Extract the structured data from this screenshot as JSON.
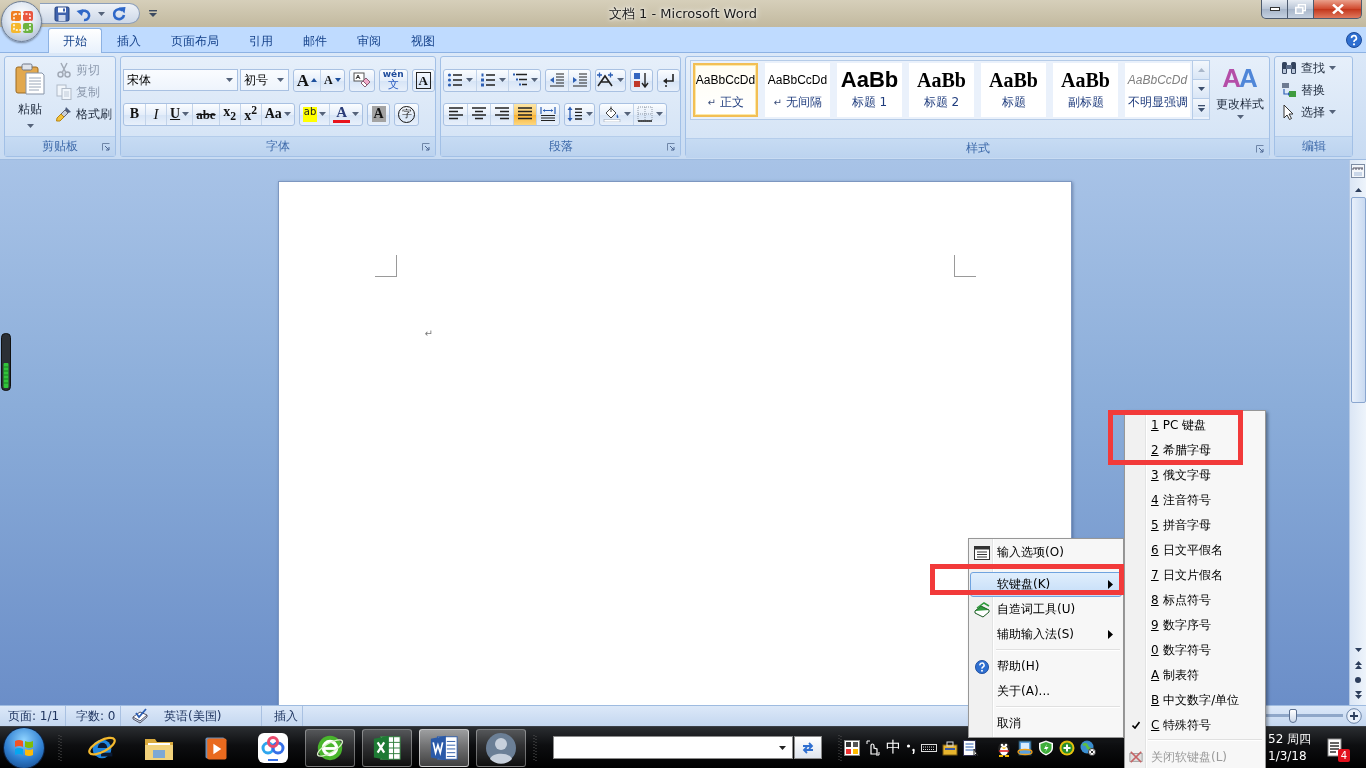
{
  "window": {
    "title": "文档 1 - Microsoft Word"
  },
  "tabs": [
    {
      "label": "开始",
      "selected": true
    },
    {
      "label": "插入",
      "selected": false
    },
    {
      "label": "页面布局",
      "selected": false
    },
    {
      "label": "引用",
      "selected": false
    },
    {
      "label": "邮件",
      "selected": false
    },
    {
      "label": "审阅",
      "selected": false
    },
    {
      "label": "视图",
      "selected": false
    }
  ],
  "clipboard": {
    "title": "剪贴板",
    "paste": "粘贴",
    "items": [
      {
        "kind": "cut",
        "label": "剪切",
        "disabled": true
      },
      {
        "kind": "copy",
        "label": "复制",
        "disabled": true
      },
      {
        "kind": "painter",
        "label": "格式刷",
        "disabled": false
      }
    ]
  },
  "font": {
    "title": "字体",
    "font_name": "宋体",
    "font_size": "初号",
    "row1": [
      [
        {
          "kind": "grow",
          "text": "A",
          "dropdown": false
        },
        {
          "kind": "shrink",
          "text": "A",
          "dropdown": false
        }
      ],
      [
        {
          "kind": "clear",
          "dropdown": false
        }
      ],
      [
        {
          "kind": "phonetic",
          "text": "wén",
          "base": "文",
          "dropdown": false
        }
      ],
      [
        {
          "kind": "border",
          "text": "A",
          "dropdown": false
        }
      ]
    ],
    "row2": [
      [
        {
          "kind": "bold",
          "text": "B",
          "dropdown": false
        },
        {
          "kind": "italic",
          "text": "I",
          "dropdown": false
        },
        {
          "kind": "underline",
          "text": "U",
          "dropdown": true
        },
        {
          "kind": "strike",
          "text": "abe",
          "dropdown": false
        },
        {
          "kind": "sub",
          "text": "x$_{2}$",
          "dropdown": false
        },
        {
          "kind": "sup",
          "text": "x$^{2}$",
          "dropdown": false
        },
        {
          "kind": "case",
          "text": "Aa",
          "dropdown": true
        }
      ],
      [
        {
          "kind": "highlight",
          "text": "ab",
          "dropdown": true
        },
        {
          "kind": "color",
          "text": "A",
          "dropdown": true
        }
      ],
      [
        {
          "kind": "shading",
          "text": "A",
          "dropdown": false
        }
      ],
      [
        {
          "kind": "enclose",
          "text": "字",
          "dropdown": false
        }
      ]
    ]
  },
  "paragraph": {
    "title": "段落",
    "alignment": [
      {
        "kind": "left",
        "selected": false
      },
      {
        "kind": "center",
        "selected": false
      },
      {
        "kind": "right",
        "selected": false
      },
      {
        "kind": "justify",
        "selected": true
      },
      {
        "kind": "distributed",
        "selected": false
      }
    ]
  },
  "styles": {
    "title": "样式",
    "gallery": [
      {
        "kind": "normal",
        "preview": "AaBbCcDd",
        "mark": "↵",
        "name": "正文",
        "selected": true
      },
      {
        "kind": "no-spacing",
        "preview": "AaBbCcDd",
        "mark": "↵",
        "name": "无间隔",
        "selected": false
      },
      {
        "kind": "heading1",
        "preview": "AaBb",
        "name": "标题 1",
        "selected": false
      },
      {
        "kind": "heading2",
        "preview": "AaBb",
        "name": "标题 2",
        "selected": false
      },
      {
        "kind": "title",
        "preview": "AaBb",
        "name": "标题",
        "selected": false
      },
      {
        "kind": "subtitle",
        "preview": "AaBb",
        "name": "副标题",
        "selected": false
      },
      {
        "kind": "emphasis",
        "preview": "AaBbCcDd",
        "name": "不明显强调",
        "selected": false
      }
    ],
    "change": {
      "glyph": "AA",
      "label": "更改样式"
    }
  },
  "editing": {
    "title": "编辑",
    "items": [
      {
        "kind": "find",
        "label": "查找",
        "dropdown": true
      },
      {
        "kind": "replace",
        "label": "替换",
        "dropdown": false
      },
      {
        "kind": "select",
        "label": "选择",
        "dropdown": true
      }
    ]
  },
  "document": {
    "paragraph_mark": "↵"
  },
  "status_bar": {
    "page": "页面: 1/1",
    "words": "字数: 0",
    "language": "英语(美国)",
    "mode": "插入",
    "zoom": {
      "level": 0.5
    }
  },
  "taskbar": {
    "apps": [
      {
        "kind": "ie",
        "running": false,
        "selected": false
      },
      {
        "kind": "folder",
        "running": false,
        "selected": false
      },
      {
        "kind": "media",
        "running": false,
        "selected": false
      },
      {
        "kind": "cloud",
        "running": false,
        "selected": false
      },
      {
        "kind": "browser360",
        "running": true,
        "selected": false
      },
      {
        "kind": "excel",
        "running": true,
        "selected": false
      },
      {
        "kind": "word",
        "running": true,
        "selected": true
      },
      {
        "kind": "avatar",
        "running": true,
        "selected": false
      }
    ],
    "ime": "中",
    "clock": {
      "time": "52 周四",
      "date": "1/3/18"
    },
    "notifications": "4"
  },
  "context_menu": {
    "items": [
      {
        "kind": "options",
        "label": "输入选项(O)",
        "selected": false,
        "submenu": false
      },
      {
        "kind": "separator"
      },
      {
        "kind": "command",
        "label": "软键盘(K)",
        "selected": true,
        "submenu": true
      },
      {
        "kind": "wordtool",
        "label": "自造词工具(U)",
        "selected": false,
        "submenu": false
      },
      {
        "kind": "command",
        "label": "辅助输入法(S)",
        "selected": false,
        "submenu": true
      },
      {
        "kind": "separator"
      },
      {
        "kind": "help",
        "label": "帮助(H)",
        "selected": false,
        "submenu": false
      },
      {
        "kind": "command",
        "label": "关于(A)...",
        "selected": false,
        "submenu": false
      },
      {
        "kind": "separator"
      },
      {
        "kind": "command",
        "label": "取消",
        "selected": false,
        "submenu": false
      }
    ]
  },
  "soft_keyboard_menu": {
    "items": [
      {
        "key": "1",
        "label": "PC 键盘",
        "checked": false
      },
      {
        "key": "2",
        "label": "希腊字母",
        "checked": false
      },
      {
        "key": "3",
        "label": "俄文字母",
        "checked": false
      },
      {
        "key": "4",
        "label": "注音符号",
        "checked": false
      },
      {
        "key": "5",
        "label": "拼音字母",
        "checked": false
      },
      {
        "key": "6",
        "label": "日文平假名",
        "checked": false
      },
      {
        "key": "7",
        "label": "日文片假名",
        "checked": false
      },
      {
        "key": "8",
        "label": "标点符号",
        "checked": false
      },
      {
        "key": "9",
        "label": "数字序号",
        "checked": false
      },
      {
        "key": "0",
        "label": "数字符号",
        "checked": false
      },
      {
        "key": "A",
        "label": "制表符",
        "checked": false
      },
      {
        "key": "B",
        "label": "中文数字/单位",
        "checked": false
      },
      {
        "key": "C",
        "label": "特殊符号",
        "checked": true
      }
    ],
    "close": {
      "label": "关闭软键盘(L)",
      "disabled": true
    }
  }
}
